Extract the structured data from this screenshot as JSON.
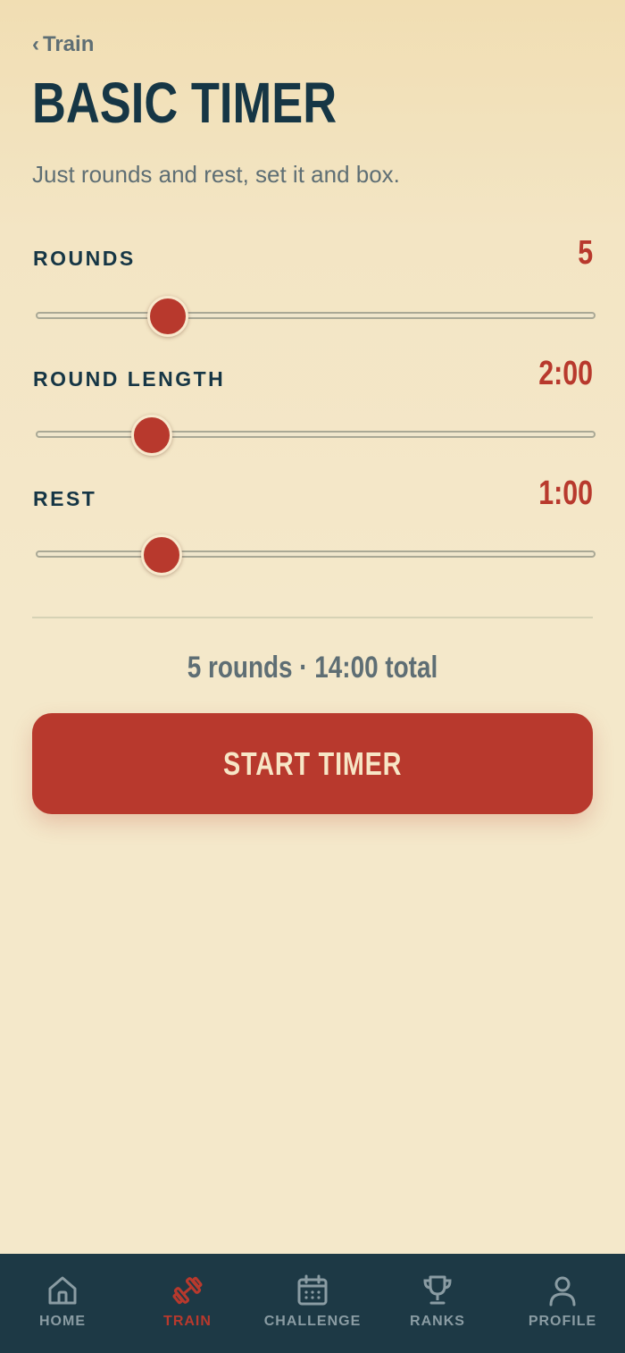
{
  "header": {
    "back_chevron": "‹",
    "back_label": "Train",
    "title": "BASIC TIMER",
    "subtitle": "Just rounds and rest, set it and box."
  },
  "settings": {
    "rounds": {
      "label": "ROUNDS",
      "value": "5",
      "slider_fraction": 0.235
    },
    "round_length": {
      "label": "ROUND LENGTH",
      "value": "2:00",
      "slider_fraction": 0.206
    },
    "rest": {
      "label": "REST",
      "value": "1:00",
      "slider_fraction": 0.224
    }
  },
  "summary": "5 rounds · 14:00 total",
  "start_button_label": "START TIMER",
  "tabs": [
    {
      "label": "HOME",
      "icon": "home-icon",
      "active": false
    },
    {
      "label": "TRAIN",
      "icon": "dumbbell-icon",
      "active": true
    },
    {
      "label": "CHALLENGE",
      "icon": "calendar-icon",
      "active": false
    },
    {
      "label": "RANKS",
      "icon": "trophy-icon",
      "active": false
    },
    {
      "label": "PROFILE",
      "icon": "person-icon",
      "active": false
    }
  ],
  "colors": {
    "accent": "#B8392D",
    "navy": "#163645",
    "tabbar": "#1D3945",
    "muted": "#5E6E74",
    "tab_inactive": "#8A9CA3",
    "background": "#F4E8CA"
  }
}
